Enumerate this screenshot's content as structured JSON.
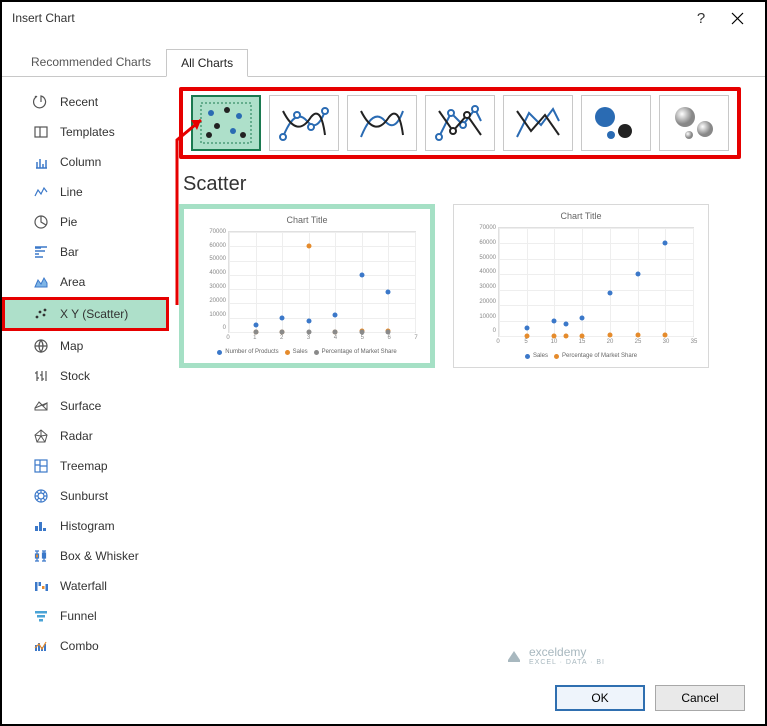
{
  "title": "Insert Chart",
  "help_glyph": "?",
  "tabs": {
    "recommended": "Recommended Charts",
    "all": "All Charts"
  },
  "sidebar": {
    "items": [
      {
        "label": "Recent"
      },
      {
        "label": "Templates"
      },
      {
        "label": "Column"
      },
      {
        "label": "Line"
      },
      {
        "label": "Pie"
      },
      {
        "label": "Bar"
      },
      {
        "label": "Area"
      },
      {
        "label": "X Y (Scatter)"
      },
      {
        "label": "Map"
      },
      {
        "label": "Stock"
      },
      {
        "label": "Surface"
      },
      {
        "label": "Radar"
      },
      {
        "label": "Treemap"
      },
      {
        "label": "Sunburst"
      },
      {
        "label": "Histogram"
      },
      {
        "label": "Box & Whisker"
      },
      {
        "label": "Waterfall"
      },
      {
        "label": "Funnel"
      },
      {
        "label": "Combo"
      }
    ]
  },
  "section_title": "Scatter",
  "chart_data": [
    {
      "type": "scatter",
      "title": "Chart Title",
      "xlabel": "",
      "ylabel": "",
      "xlim": [
        0,
        7
      ],
      "ylim": [
        0,
        70000
      ],
      "xticks": [
        0,
        1,
        2,
        3,
        4,
        5,
        6,
        7
      ],
      "yticks": [
        0,
        10000,
        20000,
        30000,
        40000,
        50000,
        60000,
        70000
      ],
      "series": [
        {
          "name": "Number of Products",
          "color": "#3b78c9",
          "points": [
            [
              1,
              5000
            ],
            [
              2,
              10000
            ],
            [
              3,
              7500
            ],
            [
              4,
              12000
            ],
            [
              5,
              40000
            ],
            [
              6,
              28000
            ]
          ]
        },
        {
          "name": "Sales",
          "color": "#e58b2c",
          "points": [
            [
              1,
              200
            ],
            [
              2,
              300
            ],
            [
              3,
              60000
            ],
            [
              4,
              300
            ],
            [
              5,
              400
            ],
            [
              6,
              500
            ]
          ]
        },
        {
          "name": "Percentage of Market Share",
          "color": "#8a8a8a",
          "points": [
            [
              1,
              100
            ],
            [
              2,
              100
            ],
            [
              3,
              100
            ],
            [
              4,
              100
            ],
            [
              5,
              100
            ],
            [
              6,
              100
            ]
          ]
        }
      ]
    },
    {
      "type": "scatter",
      "title": "Chart Title",
      "xlabel": "",
      "ylabel": "",
      "xlim": [
        0,
        35
      ],
      "ylim": [
        0,
        70000
      ],
      "xticks": [
        0,
        5,
        10,
        15,
        20,
        25,
        30,
        35
      ],
      "yticks": [
        0,
        10000,
        20000,
        30000,
        40000,
        50000,
        60000,
        70000
      ],
      "series": [
        {
          "name": "Sales",
          "color": "#3b78c9",
          "points": [
            [
              5,
              5000
            ],
            [
              10,
              10000
            ],
            [
              12,
              7500
            ],
            [
              15,
              12000
            ],
            [
              25,
              40000
            ],
            [
              20,
              28000
            ],
            [
              30,
              60000
            ]
          ]
        },
        {
          "name": "Percentage of Market Share",
          "color": "#e58b2c",
          "points": [
            [
              5,
              200
            ],
            [
              10,
              300
            ],
            [
              12,
              300
            ],
            [
              15,
              300
            ],
            [
              20,
              400
            ],
            [
              25,
              400
            ],
            [
              30,
              500
            ]
          ]
        }
      ]
    }
  ],
  "buttons": {
    "ok": "OK",
    "cancel": "Cancel"
  },
  "watermark": {
    "brand": "exceldemy",
    "tag": "EXCEL · DATA · BI"
  }
}
